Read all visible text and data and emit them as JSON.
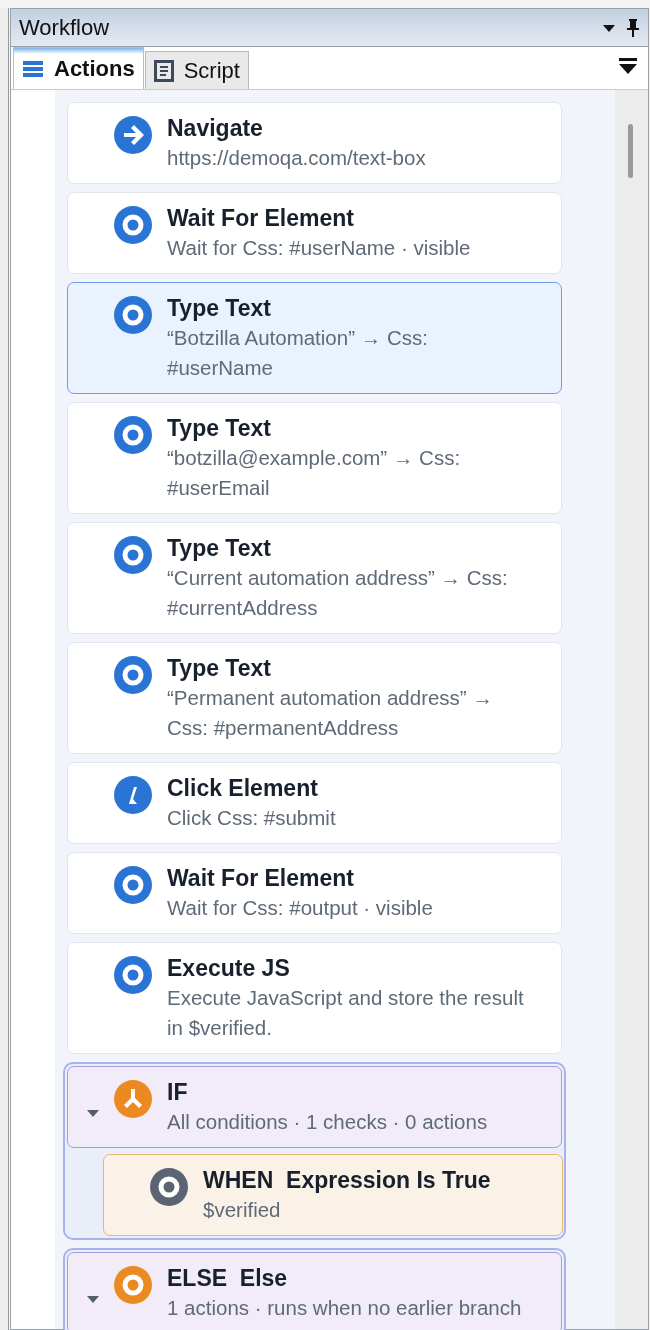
{
  "panel": {
    "title": "Workflow"
  },
  "tabs": [
    {
      "label": "Actions",
      "selected": true
    },
    {
      "label": "Script",
      "selected": false
    }
  ],
  "steps": [
    {
      "kind": "navigate",
      "title": "Navigate",
      "subtitle": "https://demoqa.com/text-box",
      "selected": false
    },
    {
      "kind": "wait",
      "title": "Wait For Element",
      "subtitle": "Wait for Css: #userName · visible",
      "selected": false
    },
    {
      "kind": "type",
      "title": "Type Text",
      "subtitle": "“Botzilla Automation” → Css: #userName",
      "selected": true
    },
    {
      "kind": "type",
      "title": "Type Text",
      "subtitle": "“botzilla@example.com” → Css: #userEmail",
      "selected": false
    },
    {
      "kind": "type",
      "title": "Type Text",
      "subtitle": "“Current automation address” → Css: #currentAddress",
      "selected": false
    },
    {
      "kind": "type",
      "title": "Type Text",
      "subtitle": "“Permanent automation address” → Css: #permanentAddress",
      "selected": false
    },
    {
      "kind": "click",
      "title": "Click Element",
      "subtitle": "Click Css: #submit",
      "selected": false
    },
    {
      "kind": "wait",
      "title": "Wait For Element",
      "subtitle": "Wait for Css: #output · visible",
      "selected": false
    },
    {
      "kind": "execute",
      "title": "Execute JS",
      "subtitle": "Execute JavaScript and store the result in $verified.",
      "selected": false
    },
    {
      "kind": "if",
      "title": "IF",
      "subtitle": "All conditions · 1 checks · 0 actions",
      "expanded": true,
      "children": [
        {
          "kind": "condition",
          "title": "WHEN  Expression Is True",
          "subtitle": "$verified"
        }
      ]
    },
    {
      "kind": "else",
      "title": "ELSE  Else",
      "subtitle": "1 actions · runs when no earlier branch",
      "expanded": true
    }
  ]
}
